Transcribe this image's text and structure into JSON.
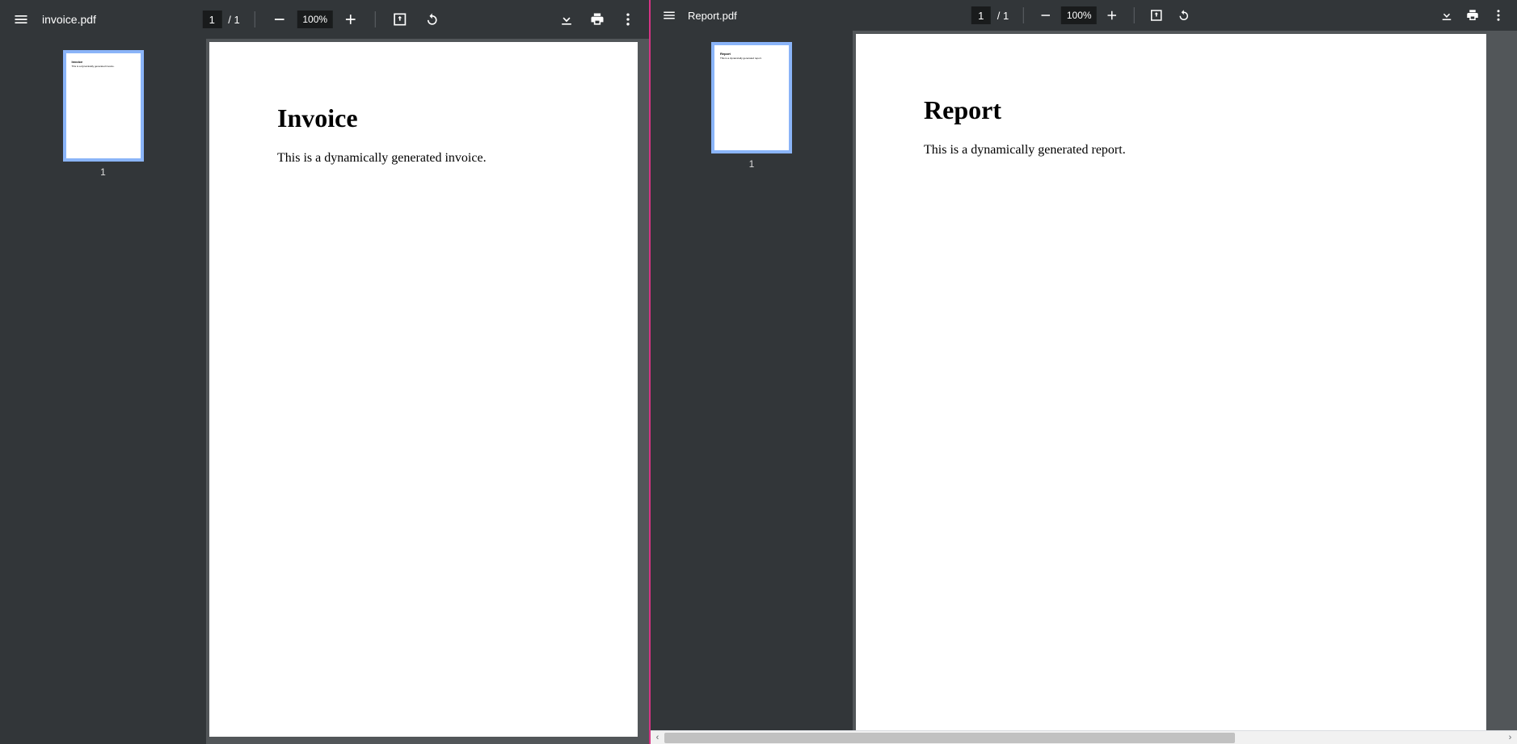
{
  "left": {
    "filename": "invoice.pdf",
    "page_current": "1",
    "page_slash": "/",
    "page_total": "1",
    "zoom": "100%",
    "thumb_num": "1",
    "doc_title": "Invoice",
    "doc_body": "This is a dynamically generated invoice."
  },
  "right": {
    "filename": "Report.pdf",
    "page_current": "1",
    "page_slash": "/",
    "page_total": "1",
    "zoom": "100%",
    "thumb_num": "1",
    "doc_title": "Report",
    "doc_body": "This is a dynamically generated report."
  }
}
